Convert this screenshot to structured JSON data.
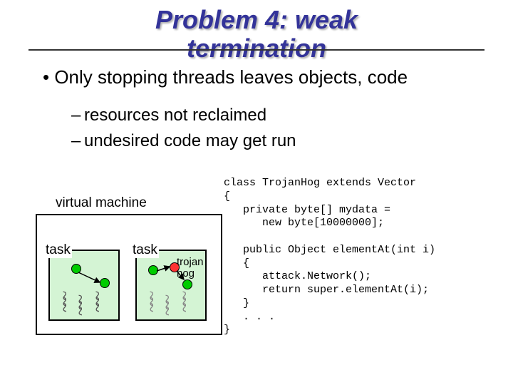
{
  "title_line1": "Problem 4: weak",
  "title_line2": "termination",
  "bullet_main": "Only stopping threads leaves objects, code",
  "sub1": "resources not reclaimed",
  "sub2": "undesired code may get run",
  "vm_label": "virtual machine",
  "task_label": "task",
  "trojan_label_line1": "trojan",
  "trojan_label_line2": "hog",
  "code": {
    "l1": "class TrojanHog extends Vector",
    "l2": "{",
    "l3": "   private byte[] mydata =",
    "l4": "      new byte[10000000];",
    "l5": "",
    "l6": "   public Object elementAt(int i)",
    "l7": "   {",
    "l8": "      attack.Network();",
    "l9": "      return super.elementAt(i);",
    "l10": "   }",
    "l11": "   . . .",
    "l12": "}"
  }
}
